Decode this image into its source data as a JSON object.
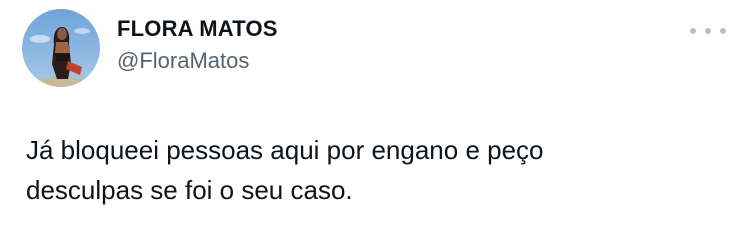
{
  "tweet": {
    "author": {
      "display_name": "FLORA MATOS",
      "handle": "@FloraMatos"
    },
    "text_line1": "Já bloqueei pessoas aqui por engano e peço",
    "text_line2": "desculpas se foi o seu caso.",
    "icons": {
      "more": "more-options-icon"
    }
  },
  "colors": {
    "name": "#0f1419",
    "handle": "#536471",
    "more_dots": "#b8c0c7"
  }
}
